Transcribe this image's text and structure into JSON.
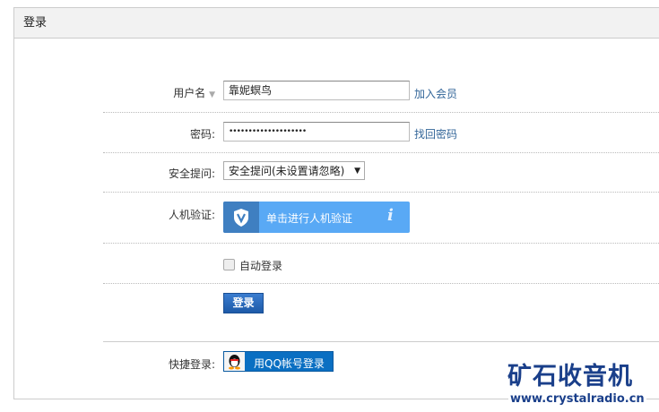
{
  "header": {
    "title": "登录"
  },
  "form": {
    "username_label": "用户名",
    "username_value": "靠妮螟鸟",
    "register_link": "加入会员",
    "password_label": "密码:",
    "password_value": "••••••••••••••••••••",
    "forgot_link": "找回密码",
    "question_label": "安全提问:",
    "question_value": "安全提问(未设置请忽略)",
    "captcha_label": "人机验证:",
    "captcha_text": "单击进行人机验证",
    "captcha_info": "i",
    "autologin_label": "自动登录",
    "login_button": "登录",
    "quick_label": "快捷登录:",
    "qq_button": "用QQ帐号登录"
  },
  "logo": {
    "title": "矿石收音机",
    "url": "www.crystalradio.cn"
  }
}
